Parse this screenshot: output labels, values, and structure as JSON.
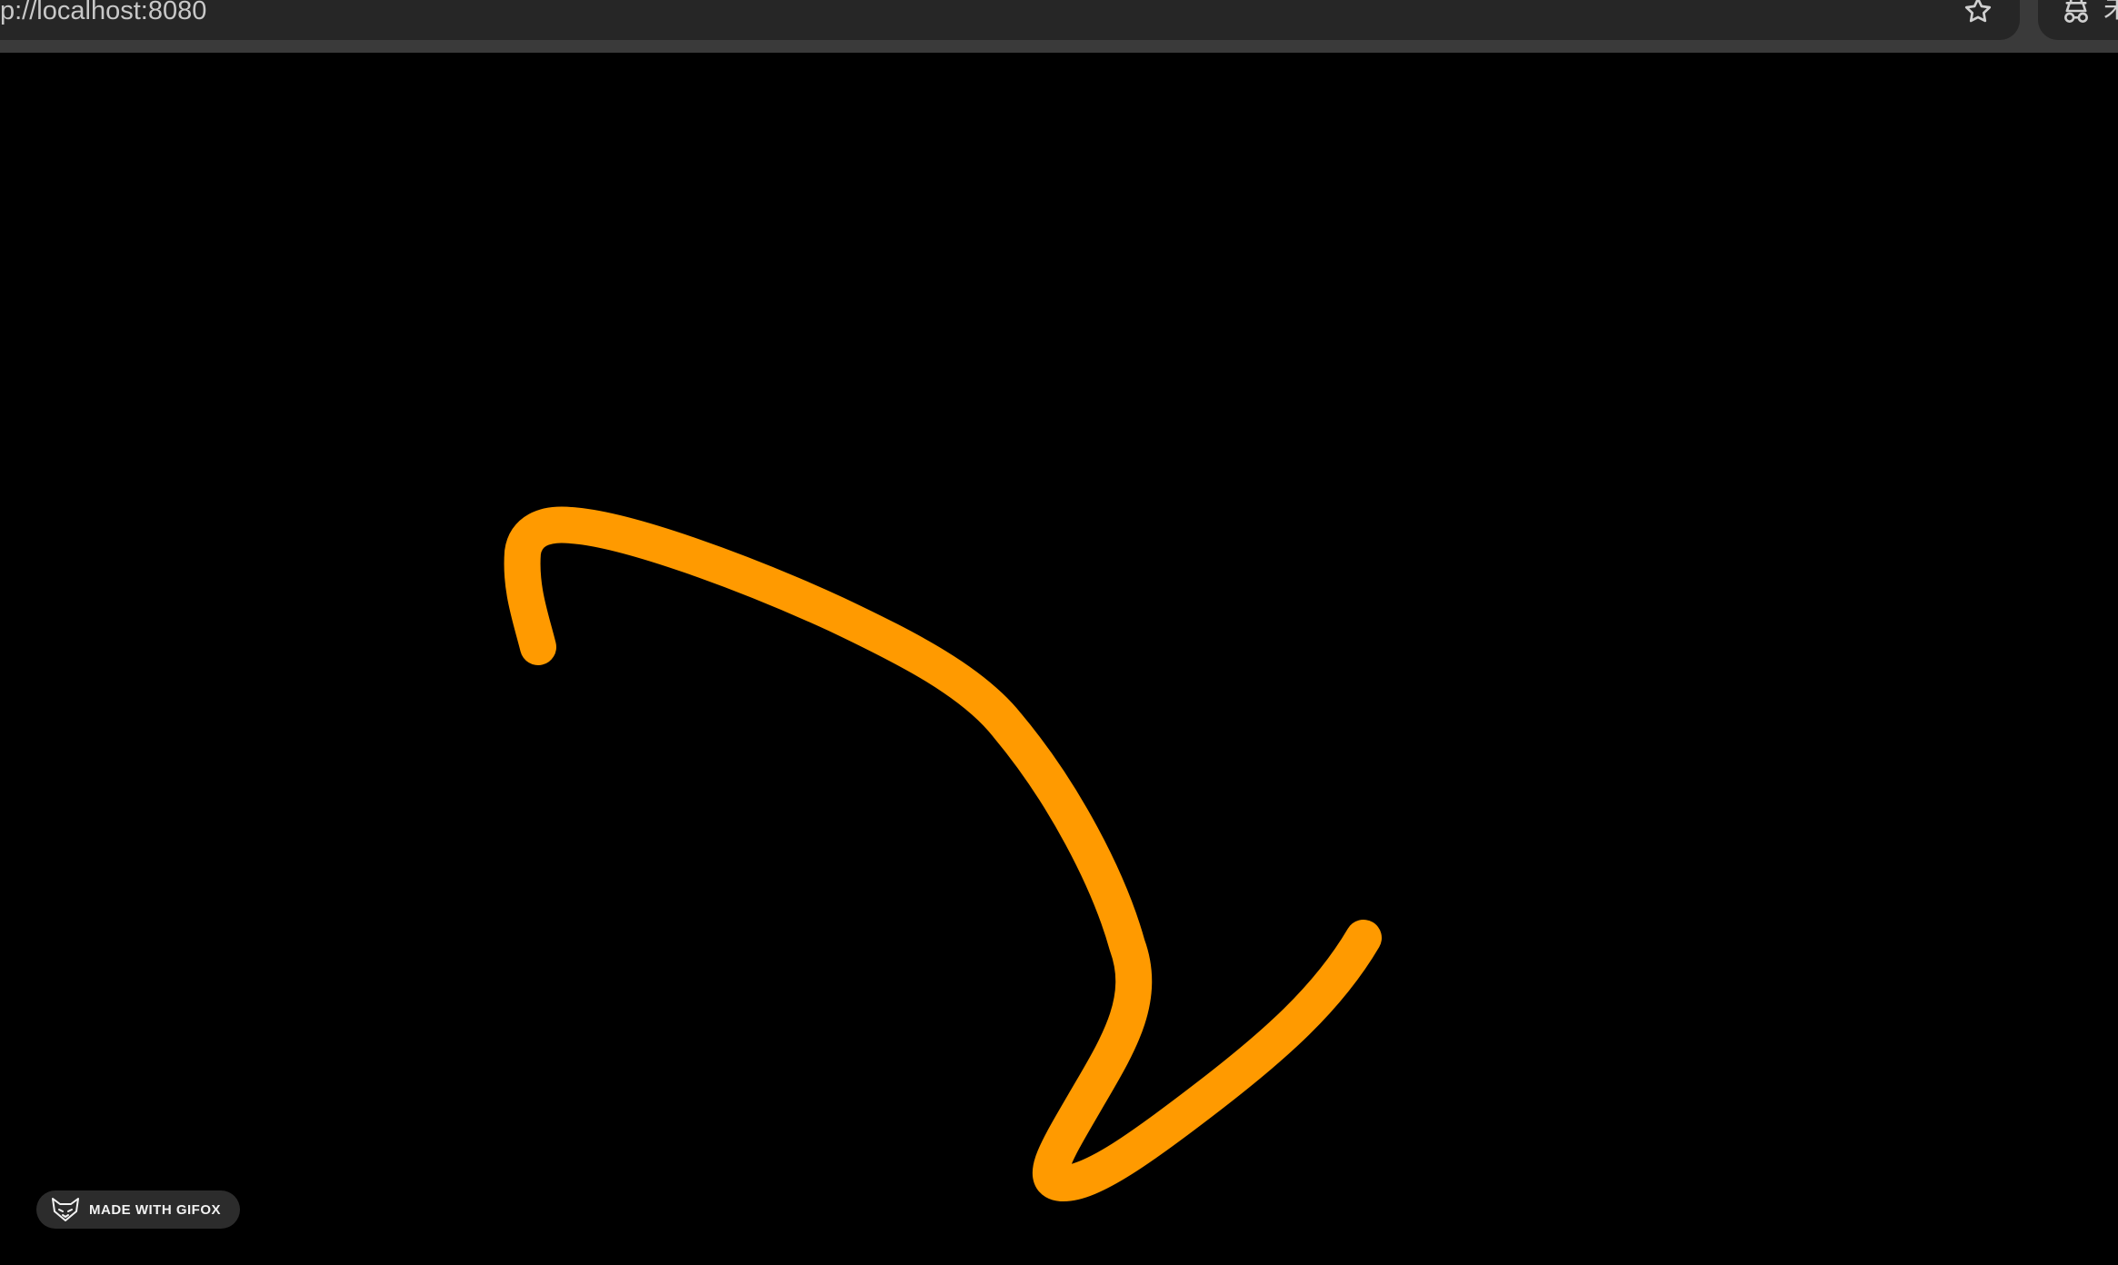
{
  "browser": {
    "url": "p://localhost:8080",
    "bookmark_icon": "star-icon",
    "extension_icon": "extension-icon",
    "extension_glyph": "未"
  },
  "canvas": {
    "background_color": "#000000",
    "stroke_color": "#ff9a00",
    "stroke_shape": "curved-arrow"
  },
  "badge": {
    "label": "MADE WITH GIFOX",
    "icon": "fox-icon"
  }
}
